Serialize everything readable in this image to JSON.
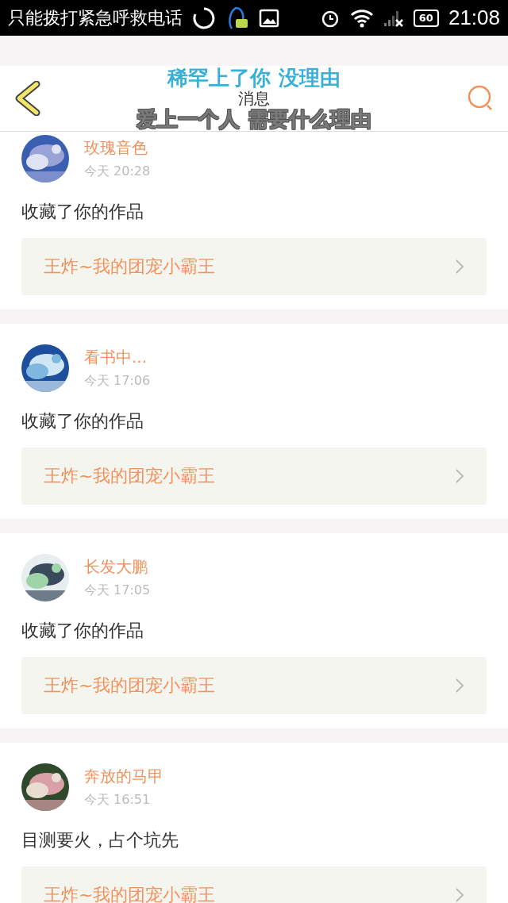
{
  "status_bar": {
    "notice": "只能拨打紧急呼救电话",
    "battery": "60",
    "time": "21:08"
  },
  "header": {
    "title": "消息"
  },
  "lyrics": [
    "稀罕上了你 没理由",
    "爱上一个人 需要什么理由"
  ],
  "messages": [
    {
      "name": "玫瑰音色",
      "time": "今天 20:28",
      "text": "收藏了你的作品",
      "work": "王炸~我的团宠小霸王"
    },
    {
      "name": "看书中...",
      "time": "今天 17:06",
      "text": "收藏了你的作品",
      "work": "王炸~我的团宠小霸王"
    },
    {
      "name": "长发大鹏",
      "time": "今天 17:05",
      "text": "收藏了你的作品",
      "work": "王炸~我的团宠小霸王"
    },
    {
      "name": "奔放的马甲",
      "time": "今天 16:51",
      "text": "目测要火，占个坑先",
      "work": "王炸~我的团宠小霸王"
    }
  ]
}
